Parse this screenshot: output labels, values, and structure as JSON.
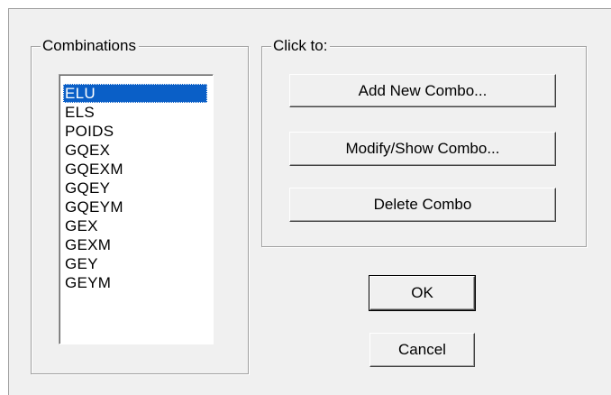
{
  "combinations_group": {
    "label": "Combinations",
    "selected_index": 0,
    "items": [
      "ELU",
      "ELS",
      "POIDS",
      "GQEX",
      "GQEXM",
      "GQEY",
      "GQEYM",
      "GEX",
      "GEXM",
      "GEY",
      "GEYM"
    ]
  },
  "actions_group": {
    "label": "Click to:",
    "add_label": "Add New Combo...",
    "modify_label": "Modify/Show Combo...",
    "delete_label": "Delete Combo"
  },
  "dialog_buttons": {
    "ok_label": "OK",
    "cancel_label": "Cancel"
  },
  "colors": {
    "selection": "#0a5fc7",
    "face": "#f0f0f0"
  }
}
